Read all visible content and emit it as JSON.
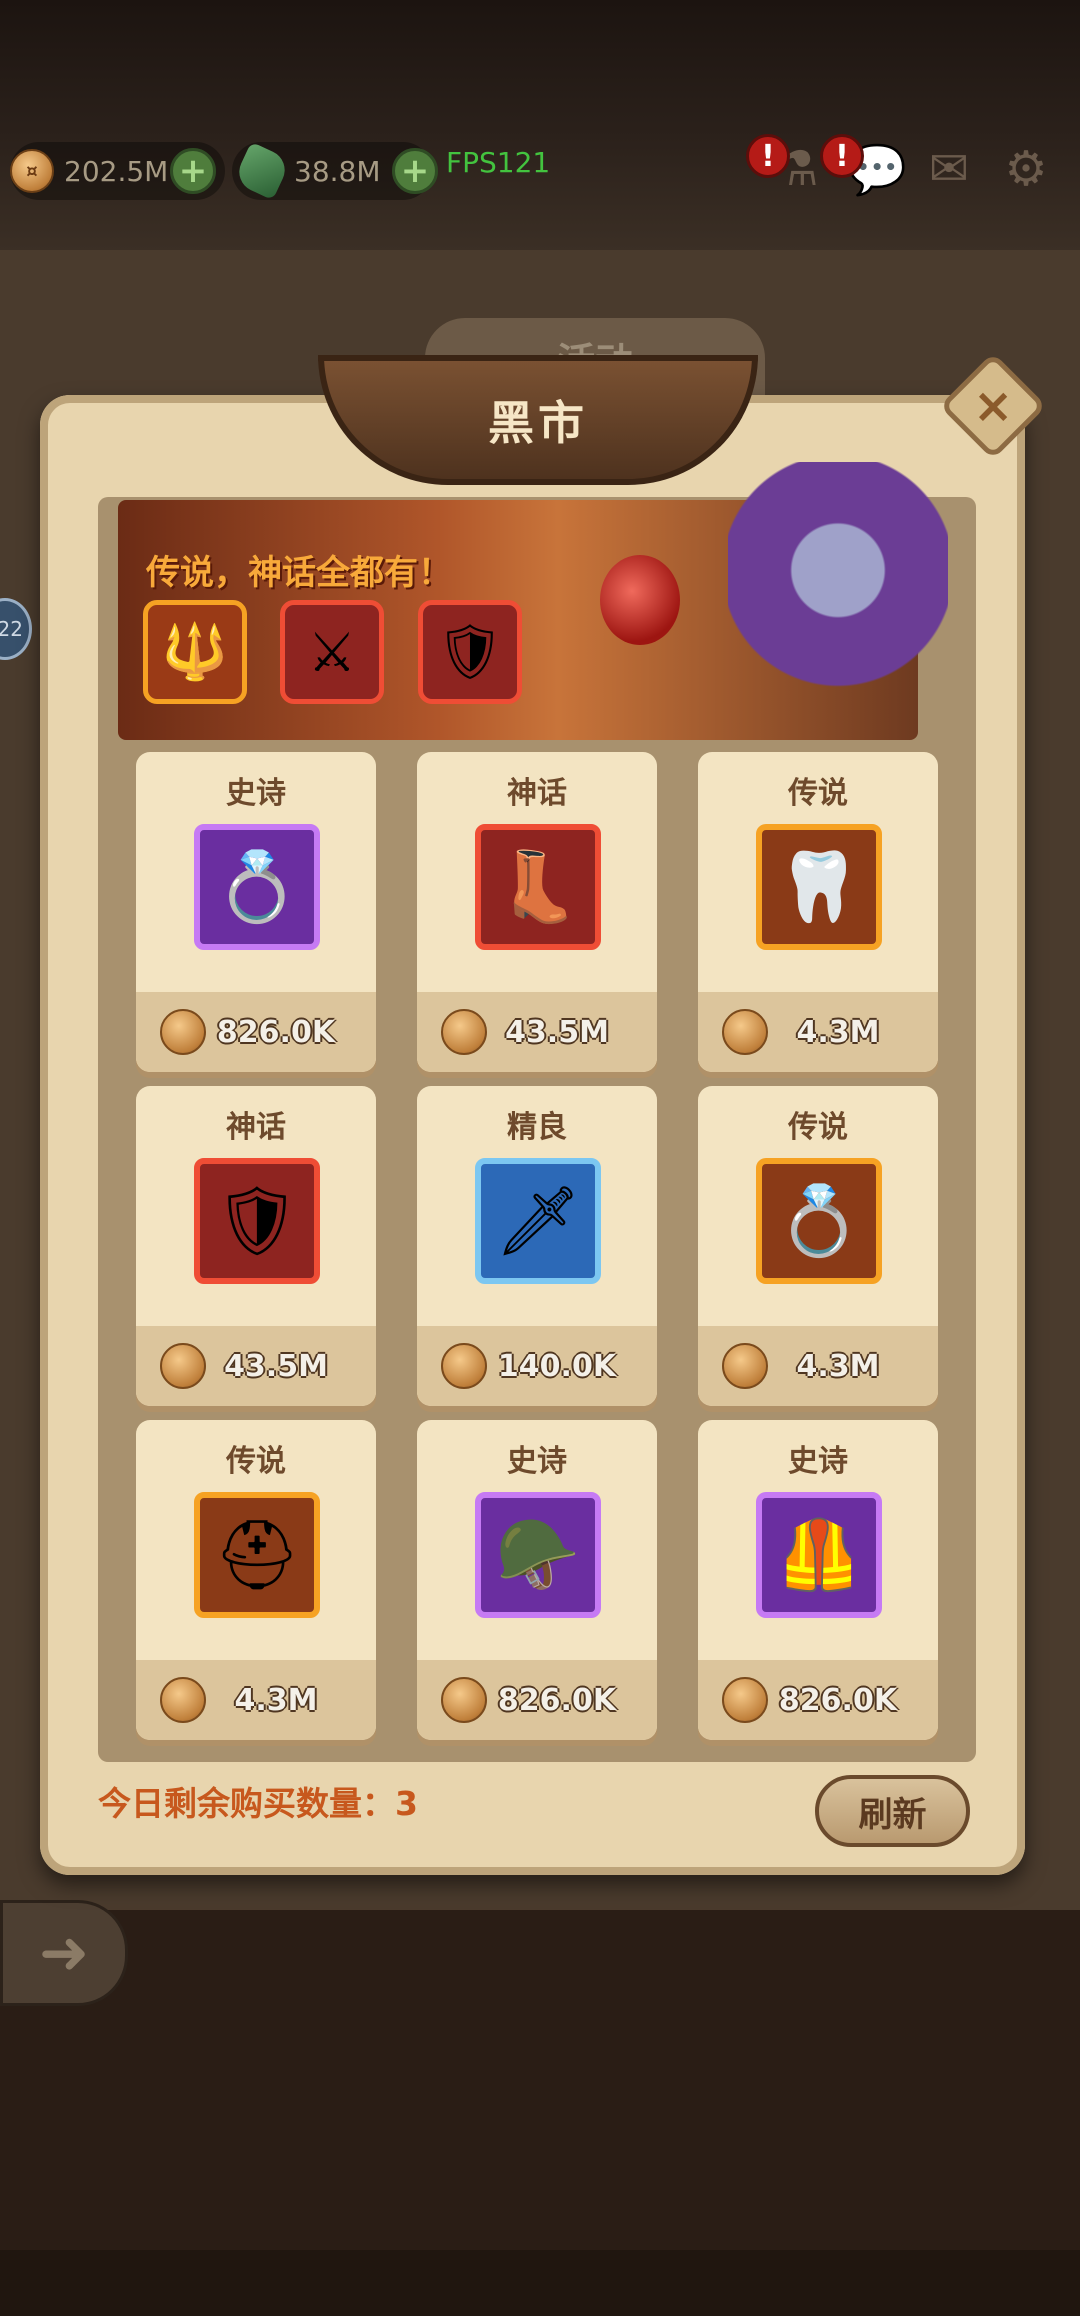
{
  "resources": {
    "gold": "202.5M",
    "gems": "38.8M",
    "fps": "FPS121"
  },
  "background": {
    "tab_label": "活动",
    "side_badge": "22"
  },
  "dialog": {
    "title": "黑市",
    "banner_text": "传说，神话全都有！",
    "remaining_label": "今日剩余购买数量：3",
    "refresh_label": "刷新"
  },
  "shop_items": [
    {
      "rarity": "史诗",
      "price": "826.0K",
      "icon": "skull-ring-icon",
      "tier": "epic"
    },
    {
      "rarity": "神话",
      "price": "43.5M",
      "icon": "boots-icon",
      "tier": "myth"
    },
    {
      "rarity": "传说",
      "price": "4.3M",
      "icon": "fang-necklace-icon",
      "tier": "legend"
    },
    {
      "rarity": "神话",
      "price": "43.5M",
      "icon": "armor-icon",
      "tier": "myth"
    },
    {
      "rarity": "精良",
      "price": "140.0K",
      "icon": "dagger-icon",
      "tier": "fine"
    },
    {
      "rarity": "传说",
      "price": "4.3M",
      "icon": "gem-ring-icon",
      "tier": "legend"
    },
    {
      "rarity": "传说",
      "price": "4.3M",
      "icon": "knight-helmet-icon",
      "tier": "legend"
    },
    {
      "rarity": "史诗",
      "price": "826.0K",
      "icon": "horned-helmet-icon",
      "tier": "epic"
    },
    {
      "rarity": "史诗",
      "price": "826.0K",
      "icon": "chest-armor-icon",
      "tier": "epic"
    }
  ],
  "colors": {
    "fps": "#43c33f",
    "remaining_text": "#c7581d",
    "dialog_bg": "#e8d5ae"
  }
}
